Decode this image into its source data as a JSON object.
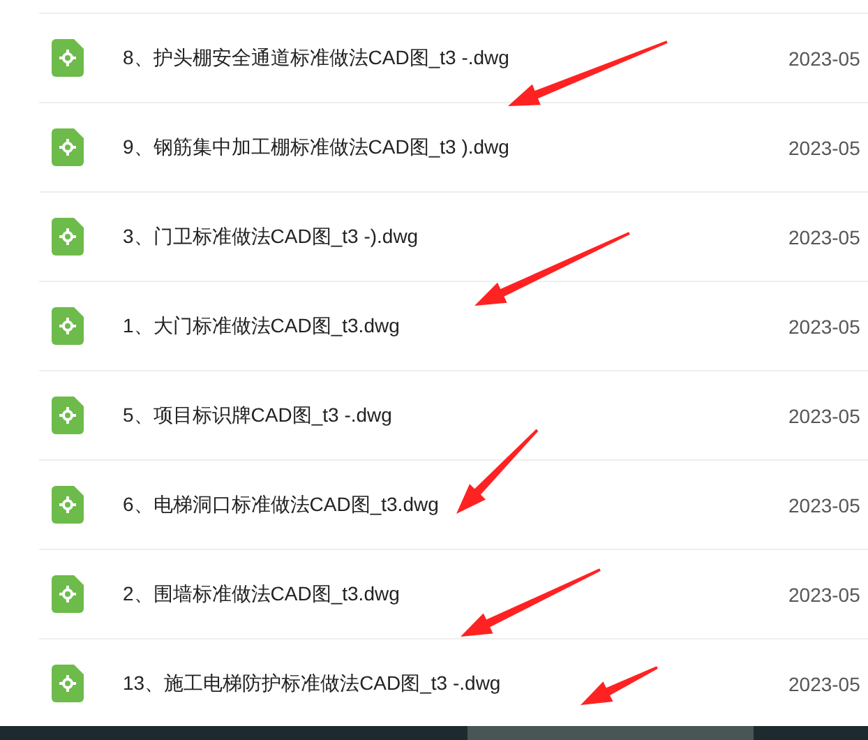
{
  "files": [
    {
      "name": "8、护头棚安全通道标准做法CAD图_t3 -.dwg",
      "date": "2023-05"
    },
    {
      "name": "9、钢筋集中加工棚标准做法CAD图_t3 ).dwg",
      "date": "2023-05"
    },
    {
      "name": "3、门卫标准做法CAD图_t3 -).dwg",
      "date": "2023-05"
    },
    {
      "name": "1、大门标准做法CAD图_t3.dwg",
      "date": "2023-05"
    },
    {
      "name": "5、项目标识牌CAD图_t3 -.dwg",
      "date": "2023-05"
    },
    {
      "name": "6、电梯洞口标准做法CAD图_t3.dwg",
      "date": "2023-05"
    },
    {
      "name": "2、围墙标准做法CAD图_t3.dwg",
      "date": "2023-05"
    },
    {
      "name": "13、施工电梯防护标准做法CAD图_t3 -.dwg",
      "date": "2023-05"
    }
  ]
}
